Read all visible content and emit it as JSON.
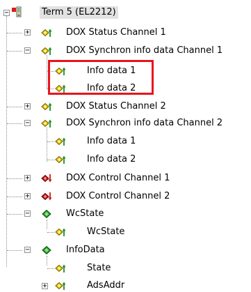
{
  "colors": {
    "highlight": "#e8141d",
    "tree_line": "#8a8a8a",
    "root_selected_bg": "#e2e2e2"
  },
  "tree": {
    "root": {
      "label": "Term 5 (EL2212)",
      "expanded": true,
      "icon": "terminal-icon"
    },
    "items": [
      {
        "label": "DOX Status Channel 1",
        "icon": "input-var-icon",
        "expanded": false,
        "has_toggle": true
      },
      {
        "label": "DOX Synchron info data Channel 1",
        "icon": "input-var-icon",
        "expanded": true,
        "has_toggle": true
      },
      {
        "label": "Info data 1",
        "icon": "input-var-icon",
        "child": true
      },
      {
        "label": "Info data 2",
        "icon": "input-var-icon",
        "child": true
      },
      {
        "label": "DOX Status Channel 2",
        "icon": "input-var-icon",
        "expanded": false,
        "has_toggle": true
      },
      {
        "label": "DOX Synchron info data Channel 2",
        "icon": "input-var-icon",
        "expanded": true,
        "has_toggle": true
      },
      {
        "label": "Info data 1",
        "icon": "input-var-icon",
        "child": true
      },
      {
        "label": "Info data 2",
        "icon": "input-var-icon",
        "child": true
      },
      {
        "label": "DOX Control Channel 1",
        "icon": "output-var-icon",
        "expanded": false,
        "has_toggle": true
      },
      {
        "label": "DOX Control Channel 2",
        "icon": "output-var-icon",
        "expanded": false,
        "has_toggle": true
      },
      {
        "label": "WcState",
        "icon": "status-group-icon",
        "expanded": true,
        "has_toggle": true
      },
      {
        "label": "WcState",
        "icon": "input-var-icon",
        "child": true
      },
      {
        "label": "InfoData",
        "icon": "status-group-icon",
        "expanded": true,
        "has_toggle": true
      },
      {
        "label": "State",
        "icon": "input-var-icon",
        "child": true
      },
      {
        "label": "AdsAddr",
        "icon": "input-var-icon",
        "child": true,
        "expanded": false,
        "has_toggle": true
      }
    ]
  }
}
